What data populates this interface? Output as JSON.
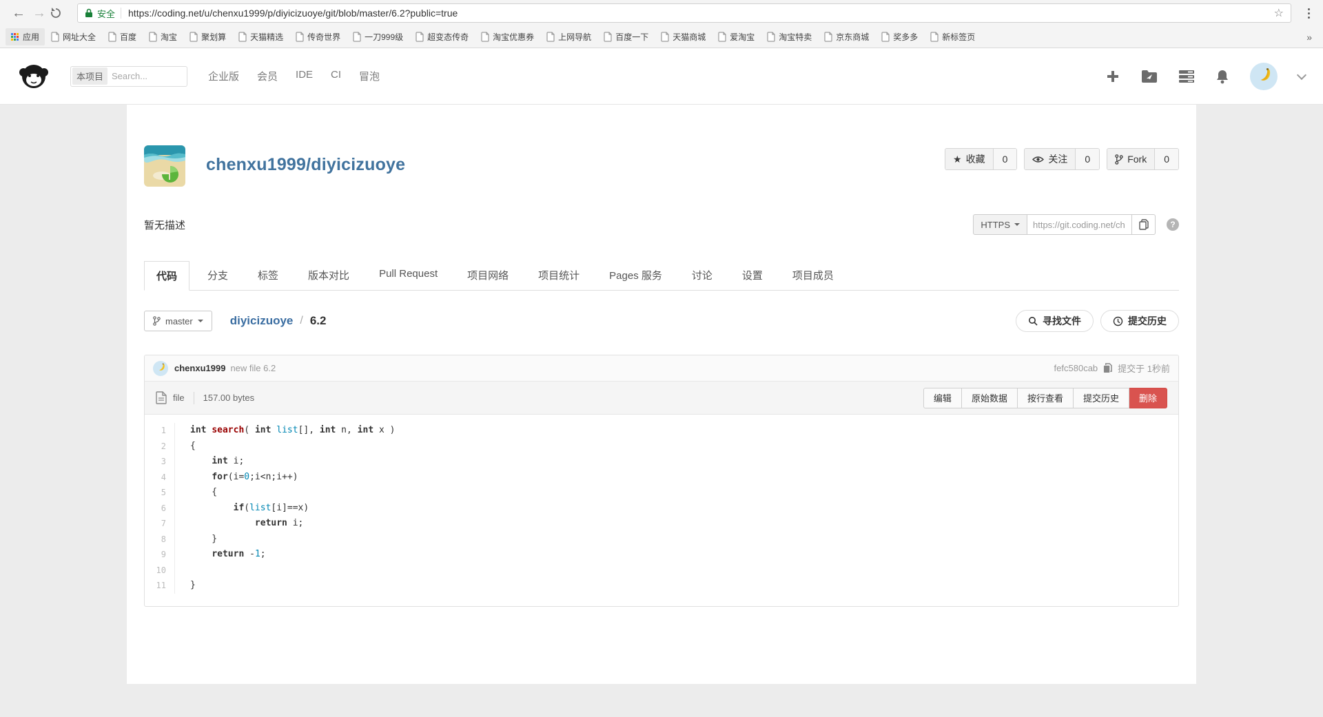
{
  "browser": {
    "back": "←",
    "forward": "→",
    "secure_label": "安全",
    "url": "https://coding.net/u/chenxu1999/p/diyicizuoye/git/blob/master/6.2?public=true",
    "bookmark_star": "☆",
    "apps_label": "应用",
    "bookmarks": [
      "网址大全",
      "百度",
      "淘宝",
      "聚划算",
      "天猫精选",
      "传奇世界",
      "一刀999级",
      "超变态传奇",
      "淘宝优惠券",
      "上网导航",
      "百度一下",
      "天猫商城",
      "爱淘宝",
      "淘宝特卖",
      "京东商城",
      "奖多多",
      "新标签页"
    ],
    "overflow_chevron": "»"
  },
  "header": {
    "search_scope": "本项目",
    "search_placeholder": "Search...",
    "nav": [
      "企业版",
      "会员",
      "IDE",
      "CI",
      "冒泡"
    ]
  },
  "repo": {
    "title": "chenxu1999/diyicizuoye",
    "description": "暂无描述",
    "actions": [
      {
        "icon": "star",
        "label": "收藏",
        "count": "0"
      },
      {
        "icon": "eye",
        "label": "关注",
        "count": "0"
      },
      {
        "icon": "fork",
        "label": "Fork",
        "count": "0"
      }
    ],
    "clone": {
      "protocol": "HTTPS",
      "url": "https://git.coding.net/ch",
      "help": "?"
    }
  },
  "tabs": {
    "items": [
      "代码",
      "分支",
      "标签",
      "版本对比",
      "Pull Request",
      "项目网络",
      "项目统计",
      "Pages 服务",
      "讨论",
      "设置",
      "项目成员"
    ],
    "active": "代码"
  },
  "breadcrumb": {
    "branch": "master",
    "repo": "diyicizuoye",
    "separator": "/",
    "path": "6.2",
    "find_file": "寻找文件",
    "history": "提交历史"
  },
  "commit": {
    "author": "chenxu1999",
    "message": "new file 6.2",
    "hash": "fefc580cab",
    "time": "提交于 1秒前"
  },
  "file": {
    "type": "file",
    "size": "157.00 bytes",
    "actions": [
      "编辑",
      "原始数据",
      "按行查看",
      "提交历史"
    ],
    "delete_label": "删除"
  },
  "code": {
    "lines": [
      [
        [
          "k",
          "int"
        ],
        [
          "p",
          " "
        ],
        [
          "f",
          "search"
        ],
        [
          "p",
          "( "
        ],
        [
          "k",
          "int"
        ],
        [
          "p",
          " "
        ],
        [
          "v",
          "list"
        ],
        [
          "p",
          "[], "
        ],
        [
          "k",
          "int"
        ],
        [
          "p",
          " n, "
        ],
        [
          "k",
          "int"
        ],
        [
          "p",
          " x )"
        ]
      ],
      [
        [
          "p",
          "{"
        ]
      ],
      [
        [
          "p",
          "    "
        ],
        [
          "k",
          "int"
        ],
        [
          "p",
          " i;"
        ]
      ],
      [
        [
          "p",
          "    "
        ],
        [
          "k",
          "for"
        ],
        [
          "p",
          "(i="
        ],
        [
          "n",
          "0"
        ],
        [
          "p",
          ";i<n;i++)"
        ]
      ],
      [
        [
          "p",
          "    {"
        ]
      ],
      [
        [
          "p",
          "        "
        ],
        [
          "k",
          "if"
        ],
        [
          "p",
          "("
        ],
        [
          "v",
          "list"
        ],
        [
          "p",
          "[i]==x)"
        ]
      ],
      [
        [
          "p",
          "            "
        ],
        [
          "k",
          "return"
        ],
        [
          "p",
          " i;"
        ]
      ],
      [
        [
          "p",
          "    }"
        ]
      ],
      [
        [
          "p",
          "    "
        ],
        [
          "k",
          "return"
        ],
        [
          "p",
          " -"
        ],
        [
          "n",
          "1"
        ],
        [
          "p",
          ";"
        ]
      ],
      [],
      [
        [
          "p",
          "}"
        ]
      ]
    ]
  },
  "colors": {
    "accent_blue": "#41739e",
    "secure_green": "#188038",
    "danger_red": "#d9534f",
    "code_keyword": "#333333",
    "code_function": "#990000",
    "code_value": "#0086b3"
  }
}
